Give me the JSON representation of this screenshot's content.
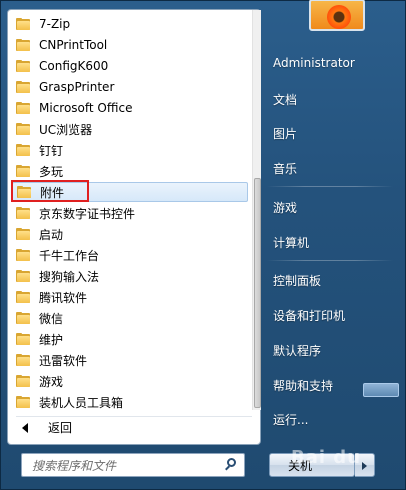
{
  "left_pane": {
    "programs": [
      {
        "label": "7-Zip",
        "icon": "folder-icon"
      },
      {
        "label": "CNPrintTool",
        "icon": "folder-icon"
      },
      {
        "label": "ConfigK600",
        "icon": "folder-icon"
      },
      {
        "label": "GraspPrinter",
        "icon": "folder-icon"
      },
      {
        "label": "Microsoft Office",
        "icon": "folder-icon"
      },
      {
        "label": "UC浏览器",
        "icon": "folder-icon"
      },
      {
        "label": "钉钉",
        "icon": "folder-icon"
      },
      {
        "label": "多玩",
        "icon": "folder-icon"
      },
      {
        "label": "附件",
        "icon": "folder-icon",
        "selected": true
      },
      {
        "label": "京东数字证书控件",
        "icon": "folder-icon"
      },
      {
        "label": "启动",
        "icon": "folder-icon"
      },
      {
        "label": "千牛工作台",
        "icon": "folder-icon"
      },
      {
        "label": "搜狗输入法",
        "icon": "folder-icon"
      },
      {
        "label": "腾讯软件",
        "icon": "folder-icon"
      },
      {
        "label": "微信",
        "icon": "folder-icon"
      },
      {
        "label": "维护",
        "icon": "folder-icon"
      },
      {
        "label": "迅雷软件",
        "icon": "folder-icon"
      },
      {
        "label": "游戏",
        "icon": "folder-icon"
      },
      {
        "label": "装机人员工具箱",
        "icon": "folder-icon"
      }
    ],
    "back_label": "返回",
    "search_placeholder": "搜索程序和文件"
  },
  "right_pane": {
    "user_name": "Administrator",
    "items": [
      {
        "label": "文档"
      },
      {
        "label": "图片"
      },
      {
        "label": "音乐"
      },
      {
        "label": "游戏"
      },
      {
        "label": "计算机"
      },
      {
        "label": "控制面板"
      },
      {
        "label": "设备和打印机"
      },
      {
        "label": "默认程序"
      },
      {
        "label": "帮助和支持"
      },
      {
        "label": "运行..."
      }
    ],
    "shutdown_label": "关机"
  },
  "watermark": "Bai du",
  "colors": {
    "highlight_box": "#e02020",
    "pane_background": "#24527c",
    "folder": "#f3c04a"
  }
}
